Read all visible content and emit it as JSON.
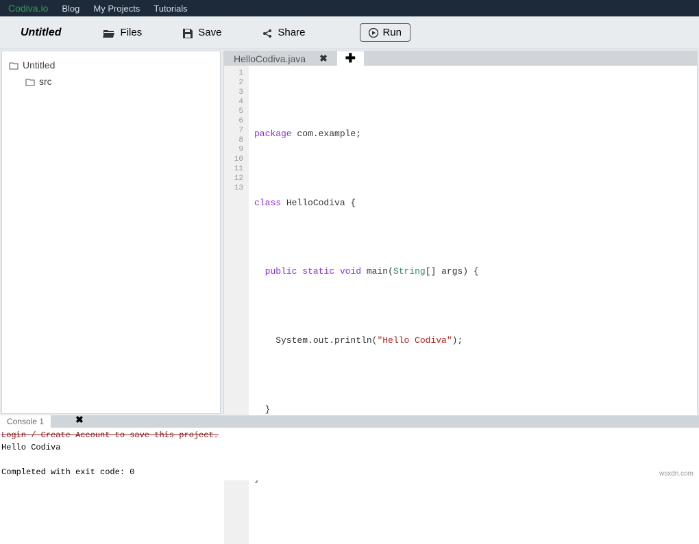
{
  "nav": {
    "brand": "Codiva.io",
    "links": [
      "Blog",
      "My Projects",
      "Tutorials"
    ]
  },
  "toolbar": {
    "title": "Untitled",
    "files": "Files",
    "save": "Save",
    "share": "Share",
    "run": "Run"
  },
  "tree": {
    "root": "Untitled",
    "src": "src"
  },
  "tabs": {
    "active": "HelloCodiva.java"
  },
  "editor": {
    "lines": [
      "1",
      "2",
      "3",
      "4",
      "5",
      "6",
      "7",
      "8",
      "9",
      "10",
      "11",
      "12",
      "13"
    ]
  },
  "code": {
    "l2_package": "package",
    "l2_rest": " com.example;",
    "l4_class": "class",
    "l4_rest": " HelloCodiva {",
    "l6_public": "public",
    "l6_static": "static",
    "l6_void": "void",
    "l6_main": " main(",
    "l6_string": "String",
    "l6_rest": "[] args) {",
    "l8_sys": "    System.out.println(",
    "l8_str": "\"Hello Codiva\"",
    "l8_end": ");",
    "l10": "  }",
    "l12": "}"
  },
  "console": {
    "tab": "Console 1",
    "login": "Login / Create Account to save this project.",
    "output": "Hello Codiva",
    "exit": "Completed with exit code: 0"
  },
  "watermark": "wsxdn.com"
}
